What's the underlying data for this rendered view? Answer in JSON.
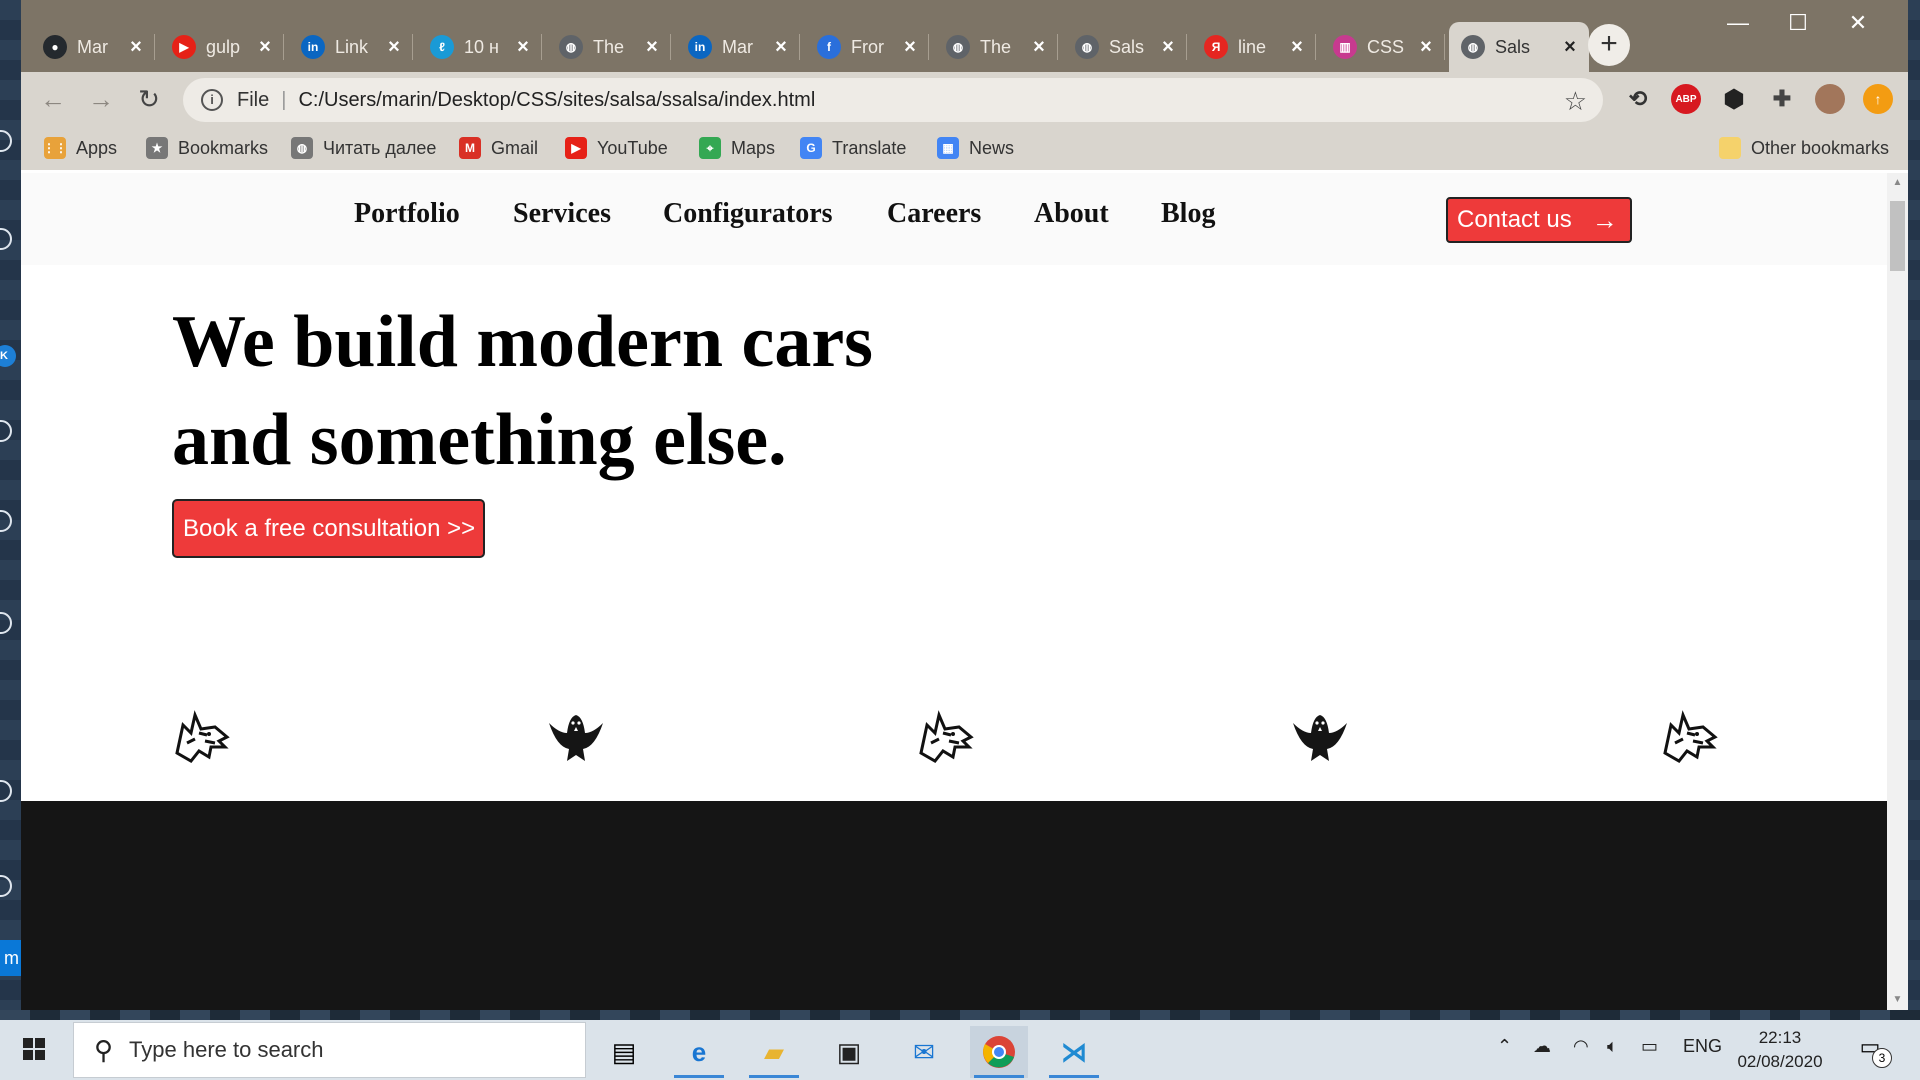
{
  "browser": {
    "tabs": [
      {
        "title": "Mar",
        "icon": "github-icon",
        "color": "#24292e"
      },
      {
        "title": "gulp",
        "icon": "youtube-icon",
        "color": "#e62117"
      },
      {
        "title": "Link",
        "icon": "linkedin-icon",
        "color": "#0a66c2"
      },
      {
        "title": "10 н",
        "icon": "letter-l-icon",
        "color": "#1a9ad6"
      },
      {
        "title": "The",
        "icon": "globe-icon",
        "color": "#5f6368"
      },
      {
        "title": "Mar",
        "icon": "linkedin-icon",
        "color": "#0a66c2"
      },
      {
        "title": "Fror",
        "icon": "frontend-icon",
        "color": "#2a6fdb"
      },
      {
        "title": "The",
        "icon": "globe-icon",
        "color": "#5f6368"
      },
      {
        "title": "Sals",
        "icon": "globe-icon",
        "color": "#5f6368"
      },
      {
        "title": "line",
        "icon": "yandex-icon",
        "color": "#e52620"
      },
      {
        "title": "CSS",
        "icon": "css-icon",
        "color": "#c73a8f"
      },
      {
        "title": "Sals",
        "icon": "globe-icon",
        "color": "#5f6368",
        "active": true
      }
    ],
    "address": {
      "scheme": "File",
      "url": "C:/Users/marin/Desktop/CSS/sites/salsa/ssalsa/index.html"
    },
    "extensions": [
      "refresh-ext-icon",
      "adblock-icon",
      "cube-ext-icon",
      "puzzle-icon",
      "profile-avatar",
      "update-icon"
    ],
    "extension_labels": {
      "adblock": "ABP"
    },
    "bookmarks": [
      {
        "label": "Apps",
        "icon": "apps-grid-icon"
      },
      {
        "label": "Bookmarks",
        "icon": "star-icon"
      },
      {
        "label": "Читать далее",
        "icon": "globe-icon"
      },
      {
        "label": "Gmail",
        "icon": "gmail-icon"
      },
      {
        "label": "YouTube",
        "icon": "youtube-icon"
      },
      {
        "label": "Maps",
        "icon": "maps-icon"
      },
      {
        "label": "Translate",
        "icon": "translate-icon"
      },
      {
        "label": "News",
        "icon": "news-icon"
      }
    ],
    "other_bookmarks": "Other bookmarks"
  },
  "site": {
    "nav": [
      "Portfolio",
      "Services",
      "Configurators",
      "Careers",
      "About",
      "Blog"
    ],
    "contact_label": "Contact us",
    "contact_arrow": "→",
    "hero_line1": "We build modern cars",
    "hero_line2": "and something else.",
    "cta_label": "Book a free consultation >>",
    "logos": [
      "wolf-logo",
      "eagle-logo",
      "wolf-logo",
      "eagle-logo",
      "wolf-logo"
    ],
    "accent": "#ee3a3a",
    "dark_bg": "#151515"
  },
  "taskbar": {
    "search_placeholder": "Type here to search",
    "apps": [
      "task-view-icon",
      "edge-icon",
      "file-explorer-icon",
      "store-icon",
      "mail-icon",
      "chrome-icon",
      "vscode-icon"
    ],
    "language": "ENG",
    "time": "22:13",
    "date": "02/08/2020",
    "notifications": "3"
  }
}
